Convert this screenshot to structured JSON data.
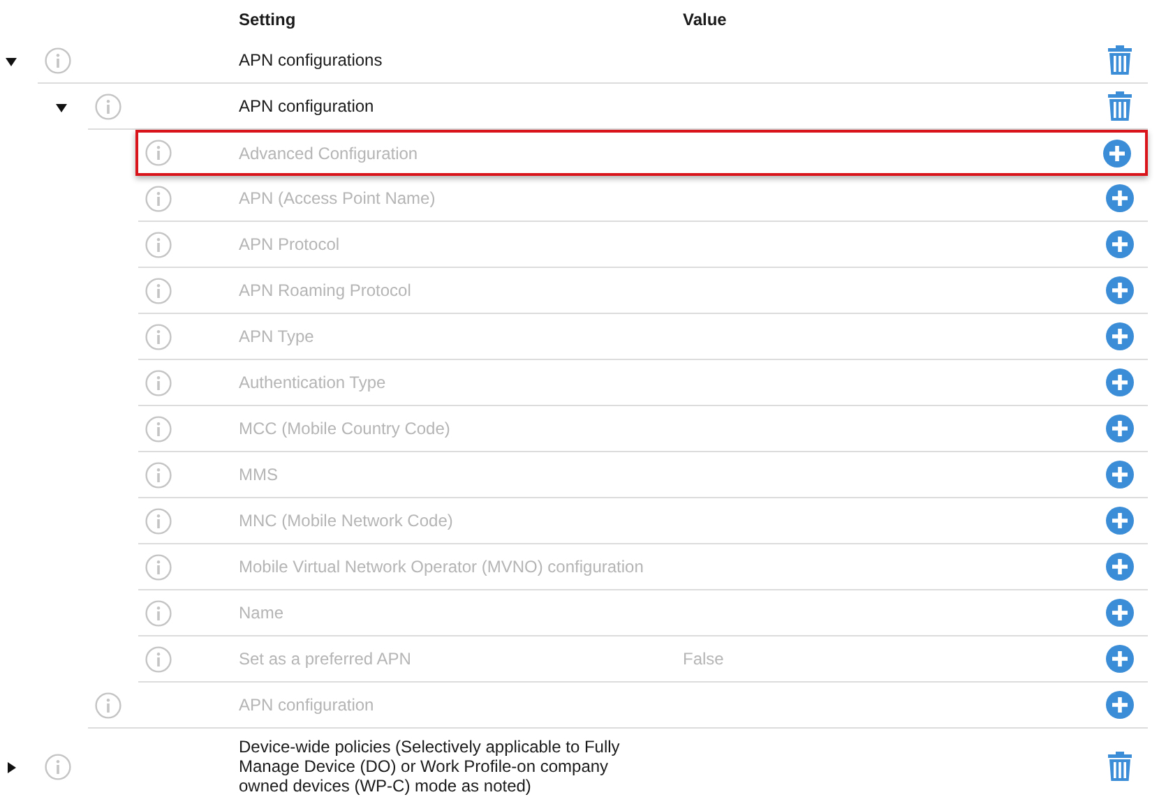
{
  "columns": [
    {
      "label": "Setting"
    },
    {
      "label": "Value"
    }
  ],
  "items": [
    {
      "setting": "APN configurations",
      "expanded": true,
      "configured": true,
      "selected": false,
      "children": [
        {
          "setting": "APN configuration",
          "expanded": true,
          "configured": true,
          "selected": false,
          "children": [
            {
              "setting": "Advanced Configuration",
              "configured": false,
              "selected": true
            },
            {
              "setting": "APN (Access Point Name)",
              "configured": false,
              "selected": false
            },
            {
              "setting": "APN Protocol",
              "configured": false,
              "selected": false
            },
            {
              "setting": "APN Roaming Protocol",
              "configured": false,
              "selected": false
            },
            {
              "setting": "APN Type",
              "configured": false,
              "selected": false
            },
            {
              "setting": "Authentication Type",
              "configured": false,
              "selected": false
            },
            {
              "setting": "MCC (Mobile Country Code)",
              "configured": false,
              "selected": false
            },
            {
              "setting": "MMS",
              "configured": false,
              "selected": false
            },
            {
              "setting": "MNC (Mobile Network Code)",
              "configured": false,
              "selected": false
            },
            {
              "setting": "Mobile Virtual Network Operator (MVNO) configuration",
              "configured": false,
              "selected": false
            },
            {
              "setting": "Name",
              "configured": false,
              "selected": false
            },
            {
              "setting": "Set as a preferred APN",
              "value": "False",
              "configured": false,
              "selected": false
            }
          ]
        },
        {
          "setting": "APN configuration",
          "configured": false,
          "selected": false
        }
      ]
    },
    {
      "setting": "Device-wide policies (Selectively applicable to Fully Manage Device (DO) or Work Profile-on company owned devices (WP-C) mode as noted)",
      "expanded": false,
      "configured": true,
      "selected": false
    }
  ]
}
